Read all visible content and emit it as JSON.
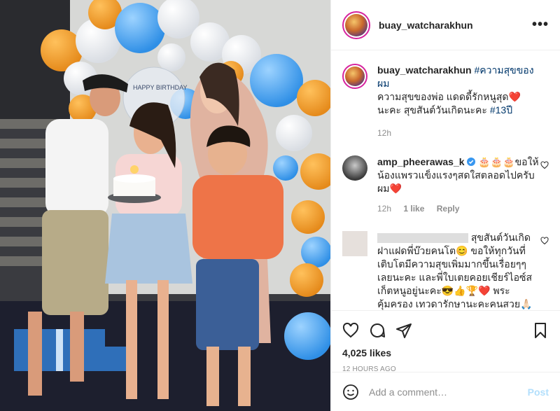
{
  "post": {
    "username": "buay_watcharakhun",
    "caption": {
      "username": "buay_watcharakhun",
      "hashtag1": "#ความสุขของผม",
      "text1": "ความสุขของพ่อ แดดดี้รักหนูสุด",
      "heart": "❤️",
      "text2": "นะคะ สุขสันต์วันเกิดนะคะ",
      "hashtag2": "#13ปี",
      "time": "12h"
    },
    "photo": {
      "balloon_text": "HAPPY BIRTHDAY"
    }
  },
  "comments": [
    {
      "username": "amp_pheerawas_k",
      "verified": true,
      "text": "🎂🎂🎂ขอให้น้องแพรวแข็งแรงๆสดใสตลอดไปครับผม",
      "heart": "❤️",
      "time": "12h",
      "likes": "1 like",
      "reply": "Reply"
    },
    {
      "username": "",
      "text": "สุขสันต์วันเกิดฝาแฝดพี่บ๊วยคนโต😊 ขอให้ทุกวันที่เติบโตมีความสุขเพิ่มมากขึ้นเรื่อยๆๆเลยนะคะ และพี่ใบเตยคอยเชียร์ไอซ์สเก็ตหนูอยู่นะคะ😎👍🏆❤️ พระคุ้มครอง เทวดารักษานะคะคนสวย🙏🏻🍰🙏🏻♀️🐞"
    }
  ],
  "actions": {
    "likes": "4,025 likes",
    "time_ago": "12 HOURS AGO"
  },
  "add_comment": {
    "placeholder": "Add a comment…",
    "post_label": "Post"
  },
  "colors": {
    "link": "#00376b",
    "muted": "#8e8e8e",
    "post_disabled": "#b2dffc",
    "verified": "#3897f0"
  }
}
